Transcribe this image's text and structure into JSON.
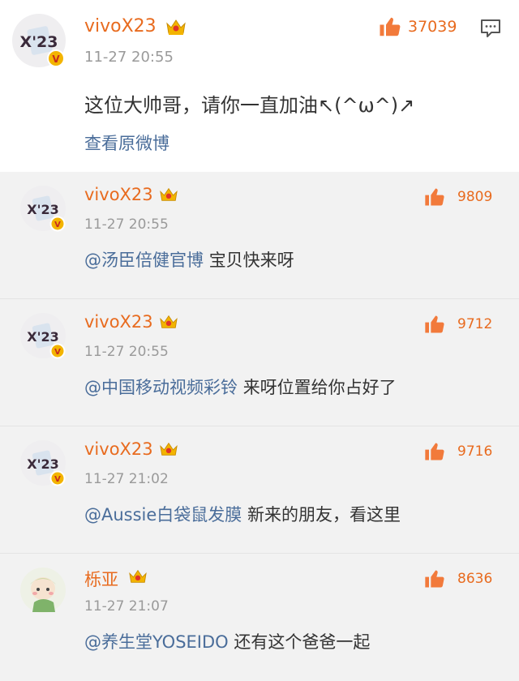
{
  "post": {
    "username": "vivoX23",
    "time": "11-27 20:55",
    "likes": "37039",
    "text": "这位大帅哥，请你一直加油↖(^ω^)↗",
    "view_original": "查看原微博"
  },
  "replies": [
    {
      "username": "vivoX23",
      "time": "11-27 20:55",
      "likes": "9809",
      "mention": "@汤臣倍健官博",
      "text": "宝贝快来呀"
    },
    {
      "username": "vivoX23",
      "time": "11-27 20:55",
      "likes": "9712",
      "mention": "@中国移动视频彩铃",
      "text": "来呀位置给你占好了"
    },
    {
      "username": "vivoX23",
      "time": "11-27 21:02",
      "likes": "9716",
      "mention": "@Aussie白袋鼠发膜",
      "text": "新来的朋友，看这里"
    },
    {
      "username": "栎亚",
      "time": "11-27 21:07",
      "likes": "8636",
      "mention": "@养生堂YOSEIDO",
      "text": "还有这个爸爸一起"
    }
  ],
  "colors": {
    "username": "#e86b1f",
    "link": "#4a6d9a",
    "meta": "#9a9a9a",
    "reply_bg": "#f2f2f2"
  },
  "icons": {
    "like": "thumbs-up-icon",
    "comment": "comment-icon",
    "vip": "crown-icon",
    "verified": "verified-v-icon"
  }
}
